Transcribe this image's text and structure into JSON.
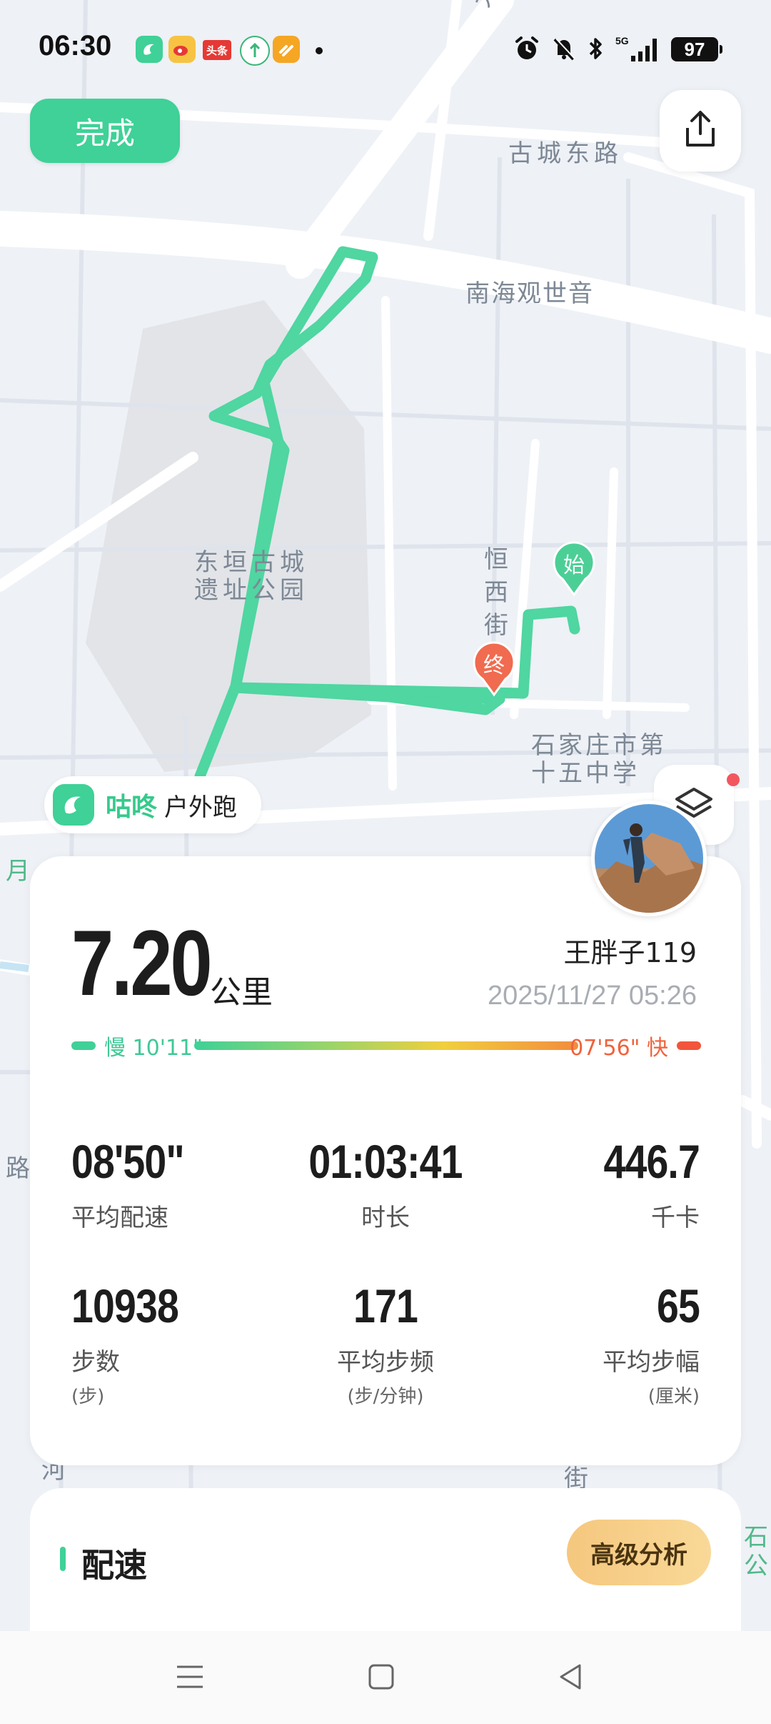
{
  "status_bar": {
    "time": "06:30",
    "notification_apps": [
      "gudong-app-icon",
      "weibo-icon",
      "toutiao-icon",
      "green-app-icon",
      "orange-app-icon"
    ],
    "toutiao_label": "头条",
    "icons": [
      "alarm-icon",
      "mute-bell-icon",
      "bluetooth-icon",
      "5g-signal-icon"
    ],
    "network_label": "5G",
    "battery": "97"
  },
  "top_bar": {
    "done_label": "完成",
    "share_icon": "share-icon"
  },
  "map": {
    "labels": {
      "dajie": "大街",
      "gucheng_east_road": "古城东路",
      "nanhai_guanyin": "南海观世音",
      "dongyuan_line1": "东垣古城",
      "dongyuan_line2": "遗址公园",
      "hengxi_street": "恒西街",
      "school_line1": "石家庄市第",
      "school_line2": "十五中学",
      "edge_yue": "月",
      "edge_lu": "路",
      "edge_he": "河",
      "edge_jie": "街",
      "edge_shi": "石",
      "edge_gong": "公"
    },
    "start_marker": "始",
    "end_marker": "终",
    "route_color": "#4fd6a1",
    "start_color": "#4ccf96",
    "end_color": "#f06b4f"
  },
  "app_badge": {
    "name": "咕咚",
    "activity": "户外跑"
  },
  "stats": {
    "distance": "7.20",
    "distance_unit": "公里",
    "user_name": "王胖子119",
    "date": "2025/11/27 05:26",
    "pace_range": {
      "slow_label": "慢 10'11\"",
      "fast_label": "07'56\" 快"
    },
    "metrics": [
      {
        "value": "08'50\"",
        "label": "平均配速"
      },
      {
        "value": "01:03:41",
        "label": "时长"
      },
      {
        "value": "446.7",
        "label": "千卡"
      },
      {
        "value": "10938",
        "label": "步数",
        "unit": "(步)"
      },
      {
        "value": "171",
        "label": "平均步频",
        "unit": "(步/分钟)"
      },
      {
        "value": "65",
        "label": "平均步幅",
        "unit": "(厘米)"
      }
    ]
  },
  "pace_section": {
    "title": "配速",
    "analysis_label": "高级分析"
  },
  "nav_bar": {
    "buttons": [
      "menu-icon",
      "home-icon",
      "back-icon"
    ]
  }
}
